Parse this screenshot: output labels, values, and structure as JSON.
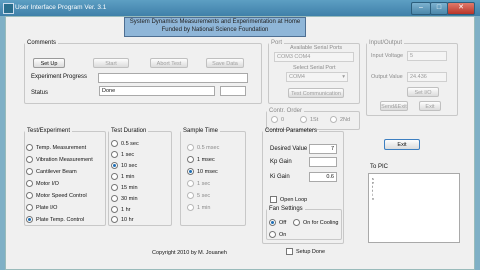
{
  "window": {
    "title": "User Interface Program Ver. 3.1",
    "min": "–",
    "max": "□",
    "close": "✕"
  },
  "banner": {
    "line1": "System Dynamics Measurements and Experimentation at Home",
    "line2": "Funded by National Science Foundation"
  },
  "comments": {
    "legend": "Comments",
    "setup": "Set Up",
    "start": "Start",
    "abort": "Abort Test",
    "save": "Save Data",
    "progress_label": "Experiment Progress",
    "status_label": "Status",
    "status_value": "Done"
  },
  "ports": {
    "legend": "Port",
    "available_label": "Available Serial Ports",
    "available_value": "COM3 COM4",
    "select_label": "Select Serial Port",
    "select_value": "COM4",
    "test_button": "Test Communication"
  },
  "input_output": {
    "legend": "Input/Output",
    "input_voltage_label": "Input Voltage",
    "input_voltage_value": "5",
    "output_value_label": "Output Value",
    "output_value_value": "24.436",
    "set_io": "Set I/O",
    "send_exit": "Send&Exit",
    "exit_small": "Exit"
  },
  "control_order": {
    "legend": "Contr. Order",
    "options": [
      "0",
      "1St",
      "2Nd"
    ]
  },
  "exit_button": "Exit",
  "test_experiment": {
    "legend": "Test/Experiment",
    "options": [
      "Temp. Measurement",
      "Vibration Measurement",
      "Cantilever Beam",
      "Motor I/O",
      "Motor Speed Control",
      "Plate I/O",
      "Plate Temp. Control"
    ],
    "selected": 6
  },
  "test_duration": {
    "legend": "Test Duration",
    "options": [
      "0.5 sec",
      "1 sec",
      "10 sec",
      "1 min",
      "15 min",
      "30 min",
      "1 hr",
      "10 hr"
    ],
    "selected": 2
  },
  "sample_time": {
    "legend": "Sample Time",
    "options": [
      "0.5 msec",
      "1 msec",
      "10 msec",
      "1 sec",
      "5 sec",
      "1 min"
    ],
    "selected": 2
  },
  "control_parameters": {
    "legend": "Control Parameters",
    "desired_label": "Desired Value",
    "desired_value": "7",
    "kp_label": "Kp Gain",
    "kp_value": "",
    "ki_label": "Ki Gain",
    "ki_value": "0.6",
    "open_loop": "Open Loop",
    "fan_legend": "Fan Settings",
    "fan_off": "Off",
    "fan_on_cooling": "On for Cooling",
    "fan_on": "On"
  },
  "to_pic": {
    "label": "To PIC",
    "lines": [
      "s",
      "e",
      "t",
      "t",
      "i",
      "n"
    ]
  },
  "footer": {
    "copyright": "Copyright 2010 by M. Jouaneh",
    "setup_done": "Setup Done"
  }
}
